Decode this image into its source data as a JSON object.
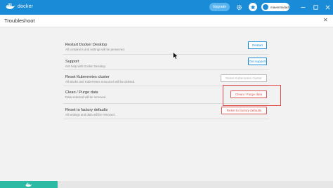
{
  "titlebar": {
    "logo_text": "docker",
    "upgrade_label": "Upgrade",
    "username": "mavenmidad"
  },
  "header": {
    "title": "Troubleshoot"
  },
  "rows": [
    {
      "label": "Restart Docker Desktop",
      "desc": "All containers and settings will be preserved.",
      "button": "Restart",
      "button_state": "enabled"
    },
    {
      "label": "Support",
      "desc": "Get help with Docker Desktop.",
      "button": "Get support",
      "button_state": "enabled"
    },
    {
      "label": "Reset Kubernetes cluster",
      "desc": "All stacks and Kubernetes resources will be deleted.",
      "button": "Reset Kubernetes cluster",
      "button_state": "disabled"
    },
    {
      "label": "Clean / Purge data",
      "desc": "Data selected will be removed.",
      "button": "Clean / Purge data",
      "button_state": "danger"
    },
    {
      "label": "Reset to factory defaults",
      "desc": "All settings and data will be removed.",
      "button": "Reset to factory defaults",
      "button_state": "danger"
    }
  ],
  "colors": {
    "accent": "#1a8bd6",
    "danger": "#d9534f",
    "highlight": "#e44c4c",
    "footer_accent": "#2dbaa4"
  },
  "icons": [
    "docker-whale-icon",
    "gear-icon",
    "bug-icon",
    "avatar",
    "minimize-icon",
    "maximize-icon",
    "close-icon",
    "mouse-cursor-icon"
  ]
}
